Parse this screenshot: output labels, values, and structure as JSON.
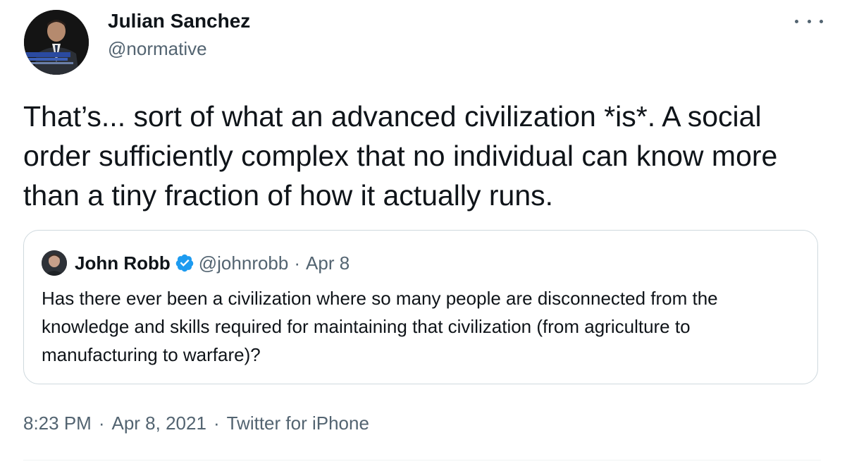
{
  "tweet": {
    "author": {
      "name": "Julian Sanchez",
      "handle": "@normative"
    },
    "text": "That’s... sort of what an advanced civilization *is*.  A social order sufficiently complex that no individual can know more than a tiny fraction of how it actually runs.",
    "quoted": {
      "name": "John Robb",
      "verified": true,
      "handle": "@johnrobb",
      "separator": "·",
      "date": "Apr 8",
      "text": "Has there ever been a civilization where so many people are disconnected from the knowledge and skills required for maintaining that civilization (from agriculture to manufacturing to warfare)?"
    },
    "meta": {
      "time": "8:23 PM",
      "separator": "·",
      "date": "Apr 8, 2021",
      "source": "Twitter for iPhone"
    }
  },
  "colors": {
    "text_primary": "#0f1419",
    "text_secondary": "#536471",
    "border": "#cfd9de",
    "verified_blue": "#1d9bf0"
  },
  "icons": {
    "more": "more-horizontal-icon",
    "verified": "verified-badge-icon"
  }
}
